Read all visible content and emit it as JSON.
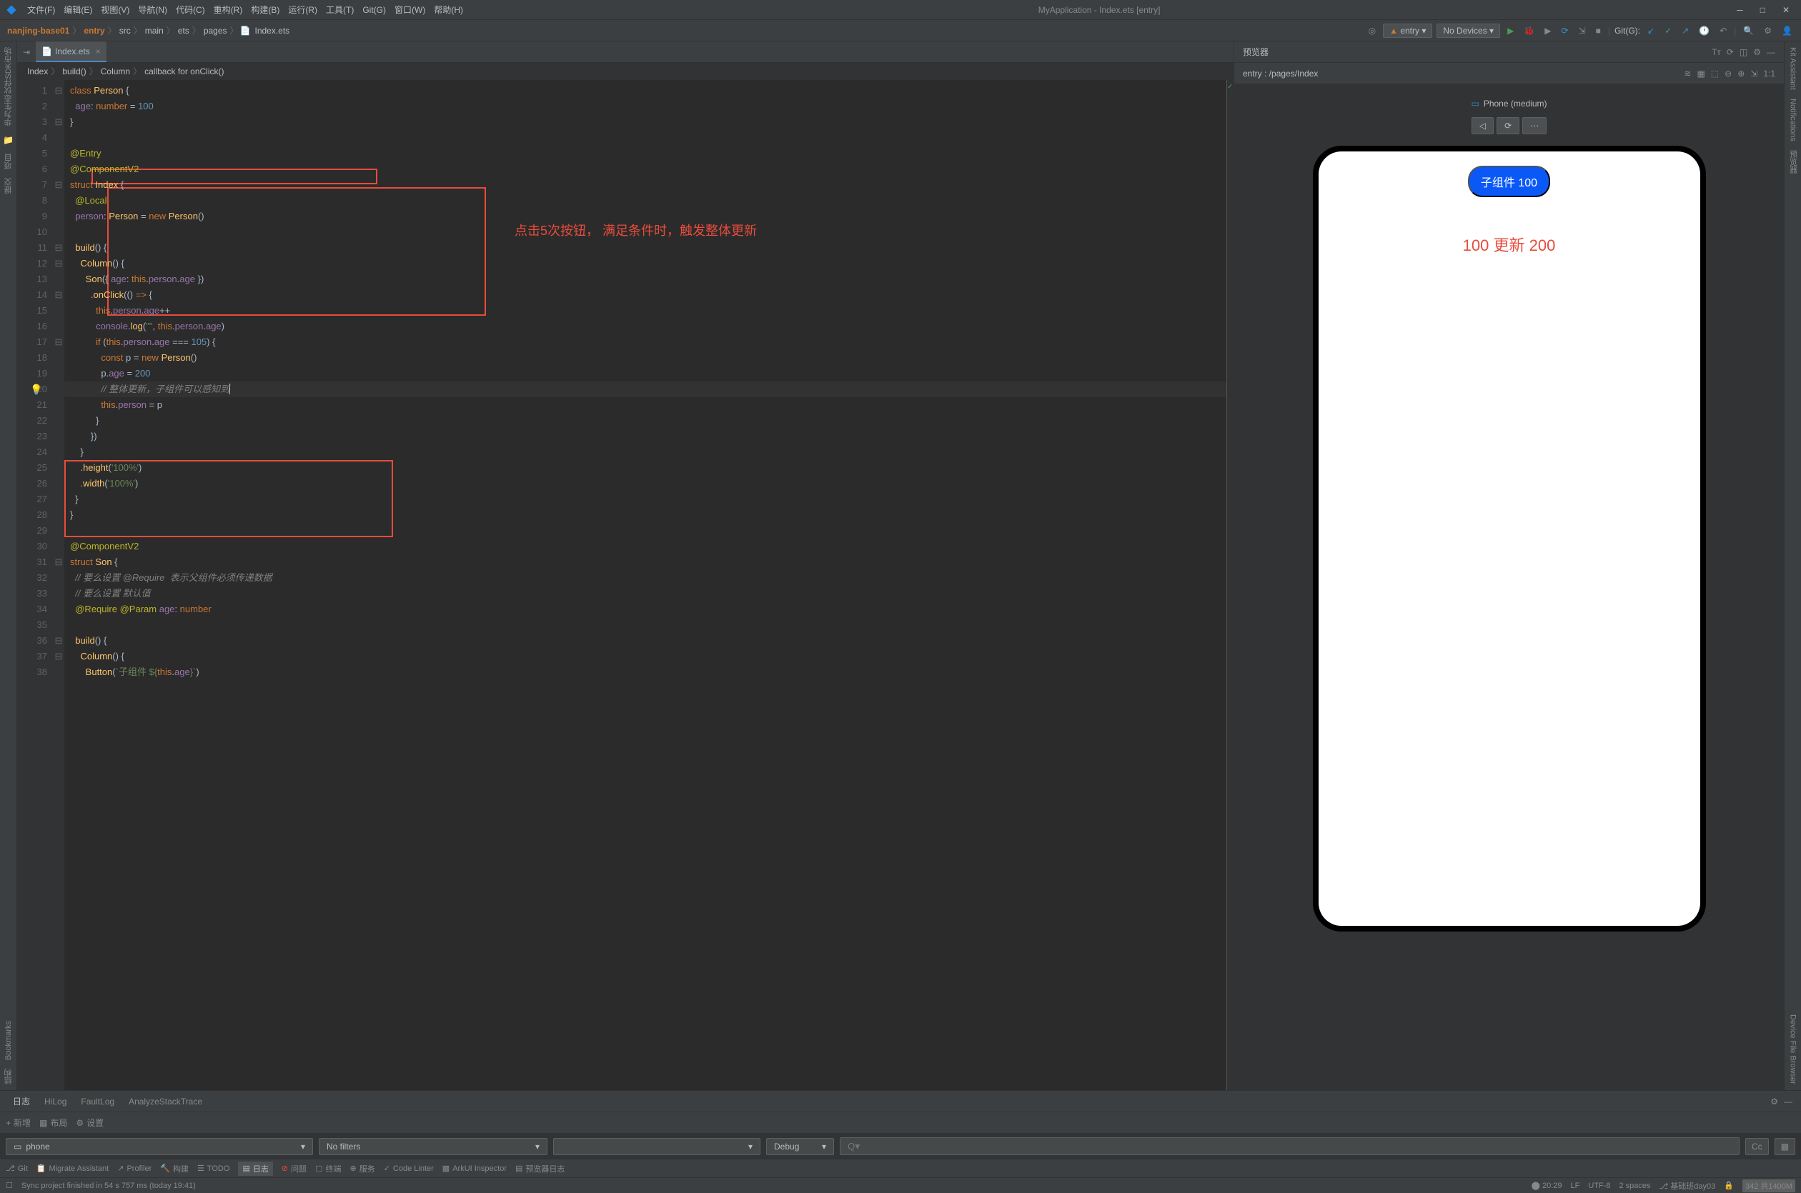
{
  "app_title": "MyApplication - Index.ets [entry]",
  "menus": [
    "文件(F)",
    "编辑(E)",
    "视图(V)",
    "导航(N)",
    "代码(C)",
    "重构(R)",
    "构建(B)",
    "运行(R)",
    "工具(T)",
    "Git(G)",
    "窗口(W)",
    "帮助(H)"
  ],
  "breadcrumb": [
    "nanjing-base01",
    "entry",
    "src",
    "main",
    "ets",
    "pages",
    "Index.ets"
  ],
  "run_config": "entry",
  "devices_dropdown": "No Devices ▾",
  "git_label": "Git(G):",
  "tab": {
    "name": "Index.ets"
  },
  "code_breadcrumb": [
    "Index",
    "build()",
    "Column",
    "callback for onClick()"
  ],
  "code": {
    "l1": "class Person {",
    "l2": "  age: number = 100",
    "l3": "}",
    "l4": "",
    "l5": "@Entry",
    "l6": "@ComponentV2",
    "l7": "struct Index {",
    "l8": "  @Local",
    "l9": "  person: Person = new Person()",
    "l10": "",
    "l11": "  build() {",
    "l12": "    Column() {",
    "l13": "      Son({ age: this.person.age })",
    "l14": "        .onClick(() => {",
    "l15": "          this.person.age++",
    "l16": "          console.log(\"\", this.person.age)",
    "l17": "          if (this.person.age === 105) {",
    "l18": "            const p = new Person()",
    "l19": "            p.age = 200",
    "l20_a": "            // ",
    "l20_b": "整体更新，子组件可以感知到",
    "l21": "            this.person = p",
    "l22": "          }",
    "l23": "        })",
    "l24": "    }",
    "l25": "    .height('100%')",
    "l26": "    .width('100%')",
    "l27": "  }",
    "l28": "}",
    "l29": "",
    "l30": "@ComponentV2",
    "l31": "struct Son {",
    "l32_a": "  // ",
    "l32_b": "要么设置 @Require  表示父组件必须传递数据",
    "l33_a": "  // ",
    "l33_b": "要么设置 默认值",
    "l34": "  @Require @Param age: number",
    "l35": "",
    "l36": "  build() {",
    "l37": "    Column() {",
    "l38": "      Button(`子组件 ${this.age}`)"
  },
  "annotation_text": "点击5次按钮，  满足条件时，触发整体更新",
  "preview": {
    "title": "预览器",
    "path": "entry : /pages/Index",
    "device_label": "Phone (medium)",
    "button_text": "子组件 100",
    "red_text": "100 更新 200"
  },
  "right_sidebar": [
    "Kit Assistant",
    "Notifications",
    "预览器",
    "Device File Browser"
  ],
  "left_sidebar": [
    "华为生态伙伴SDK市场",
    "项目",
    "提交",
    "Bookmarks",
    "结构"
  ],
  "bottom_tabs": [
    "日志",
    "HiLog",
    "FaultLog",
    "AnalyzeStackTrace"
  ],
  "toolbar": {
    "add": "新增",
    "layout": "布局",
    "settings": "设置"
  },
  "filters": {
    "device": "phone",
    "filter": "No filters",
    "level": "Debug",
    "search_placeholder": "Q▾",
    "cc": "Cc"
  },
  "footer": {
    "items": [
      "Git",
      "Migrate Assistant",
      "Profiler",
      "构建",
      "TODO",
      "日志",
      "问题",
      "终端",
      "服务",
      "Code Linter",
      "ArkUI Inspector",
      "预览器日志"
    ]
  },
  "status": {
    "sync_msg": "Sync project finished in 54 s 757 ms (today 19:41)",
    "time": "20:29",
    "lf": "LF",
    "encoding": "UTF-8",
    "spaces": "2 spaces",
    "branch": "基础班day03",
    "mem": "342 共1400M"
  }
}
